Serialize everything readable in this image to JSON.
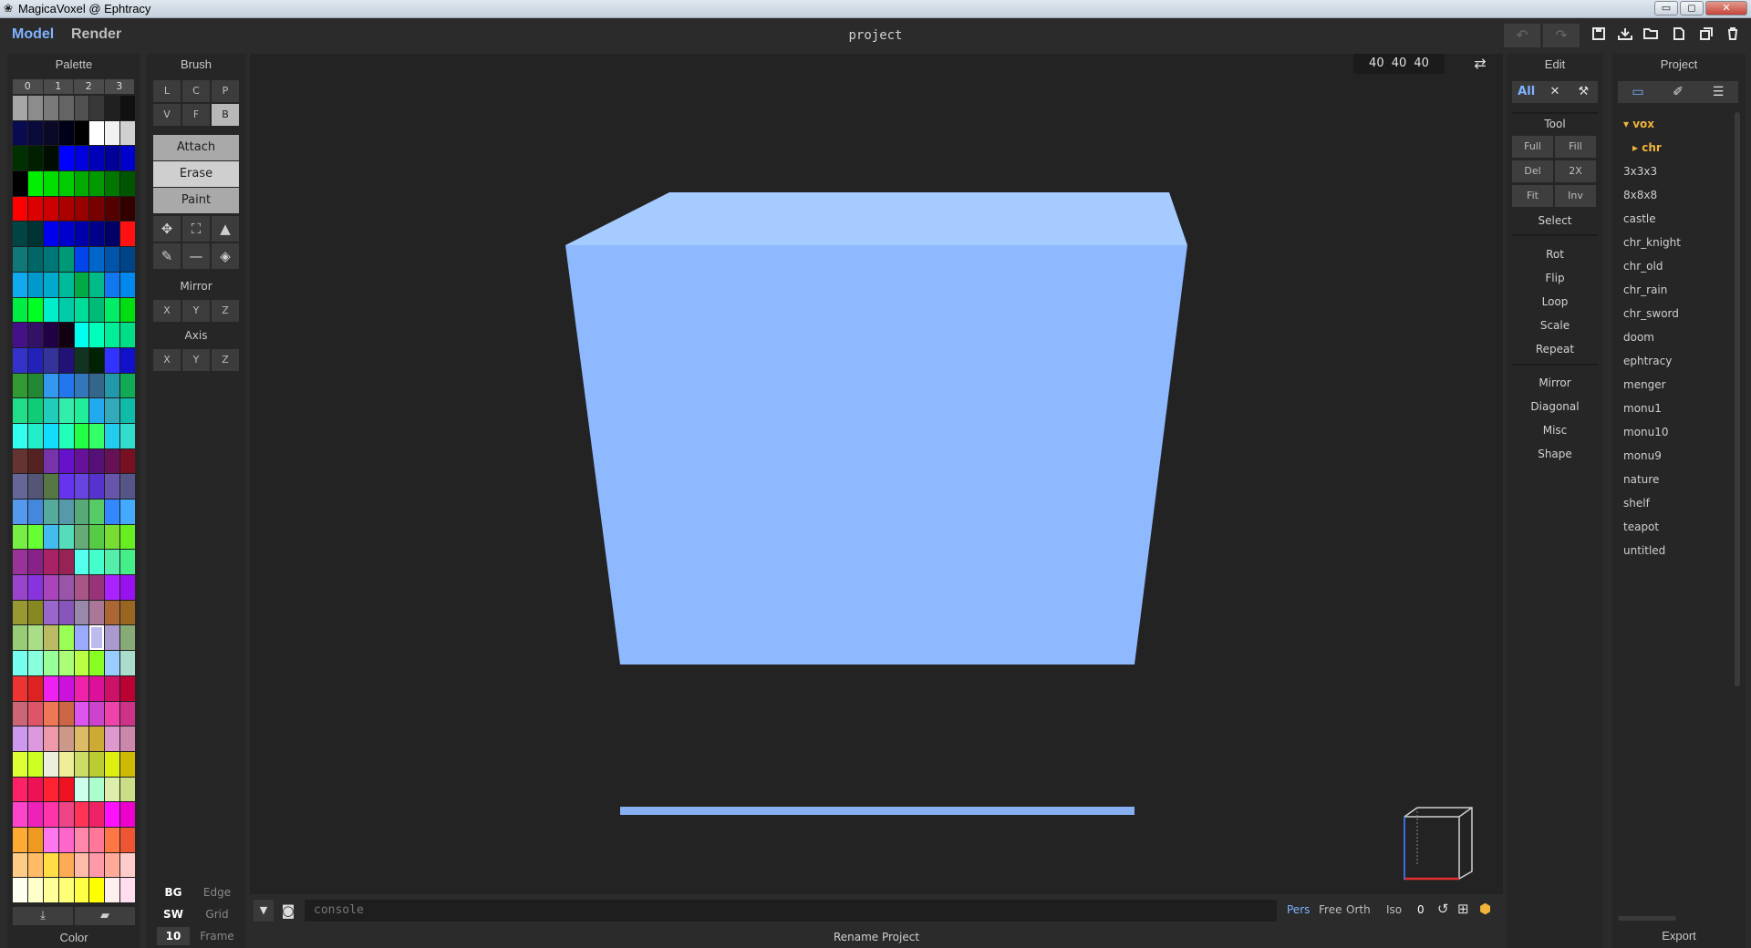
{
  "window": {
    "title": "MagicaVoxel @ Ephtracy",
    "minimize": "▭",
    "maximize": "◻",
    "close": "✕"
  },
  "header": {
    "modes": [
      "Model",
      "Render"
    ],
    "active_mode": "Model",
    "project_title": "project",
    "icons": [
      "undo-icon",
      "redo-icon",
      "save-icon",
      "save-as-icon",
      "open-icon",
      "new-icon",
      "duplicate-icon",
      "delete-icon"
    ]
  },
  "palette": {
    "title": "Palette",
    "tabs": [
      "0",
      "1",
      "2",
      "3"
    ],
    "footer_label": "Color",
    "selected_index": 173,
    "colors": [
      "#a6a6a6",
      "#8c8c8c",
      "#7a7a7a",
      "#646464",
      "#505050",
      "#383838",
      "#202020",
      "#101010",
      "#0a0a50",
      "#0a0a3a",
      "#0a0a28",
      "#000018",
      "#000000",
      "#ffffff",
      "#f2f2f2",
      "#d0d0d0",
      "#003000",
      "#002000",
      "#000e00",
      "#0000ff",
      "#0000dd",
      "#0000bb",
      "#000099",
      "#0000cc",
      "#000000",
      "#00ee00",
      "#00dd00",
      "#00cc00",
      "#00aa00",
      "#009900",
      "#007700",
      "#005500",
      "#ff0000",
      "#dd0000",
      "#cc0000",
      "#aa0000",
      "#990000",
      "#770000",
      "#550000",
      "#330000",
      "#004444",
      "#003333",
      "#0000ee",
      "#0000cc",
      "#0000aa",
      "#000088",
      "#000066",
      "#ff1111",
      "#117777",
      "#006666",
      "#007777",
      "#009977",
      "#0044ee",
      "#0066cc",
      "#0055aa",
      "#004488",
      "#11aaee",
      "#0099cc",
      "#00aacc",
      "#00bb99",
      "#00aa44",
      "#00bb88",
      "#1177ee",
      "#0088ee",
      "#00ee44",
      "#00ff22",
      "#00eecc",
      "#00ccaa",
      "#00dd99",
      "#00bb77",
      "#00ee66",
      "#00dd11",
      "#441188",
      "#331166",
      "#220044",
      "#110011",
      "#00ffee",
      "#00ffbb",
      "#00ee99",
      "#00dd88",
      "#3333cc",
      "#2222bb",
      "#333399",
      "#221177",
      "#113322",
      "#002200",
      "#3333ff",
      "#1111cc",
      "#339933",
      "#228833",
      "#3399ee",
      "#2277ee",
      "#3377bb",
      "#336688",
      "#2299aa",
      "#11aa55",
      "#22dd88",
      "#11cc77",
      "#22ccbb",
      "#33eeaa",
      "#22ee99",
      "#22aaee",
      "#33aabb",
      "#11bbaa",
      "#33ffee",
      "#22eecc",
      "#11ddff",
      "#22ffbb",
      "#22ff44",
      "#33ff66",
      "#22ccee",
      "#33ddcc",
      "#663333",
      "#552222",
      "#7733aa",
      "#6611cc",
      "#661199",
      "#551177",
      "#661155",
      "#771122",
      "#666699",
      "#555577",
      "#557744",
      "#6633ee",
      "#6644dd",
      "#5533cc",
      "#6655aa",
      "#555588",
      "#5599ee",
      "#4488dd",
      "#55aa99",
      "#5599aa",
      "#55aa77",
      "#55cc66",
      "#3388ff",
      "#44aaff",
      "#77ee44",
      "#66ff33",
      "#44bbee",
      "#55ddbb",
      "#66aa77",
      "#55cc44",
      "#77dd33",
      "#66ee22",
      "#993399",
      "#882288",
      "#aa2266",
      "#992255",
      "#55ffee",
      "#44ffcc",
      "#55eeaa",
      "#44ee88",
      "#9944cc",
      "#8833dd",
      "#aa44bb",
      "#9955aa",
      "#aa5588",
      "#993377",
      "#aa22ff",
      "#9911ee",
      "#999933",
      "#888822",
      "#9966cc",
      "#8855bb",
      "#9988aa",
      "#aa7799",
      "#aa6633",
      "#996622",
      "#99cc77",
      "#aadd88",
      "#bbbb66",
      "#99ff55",
      "#99aaff",
      "#bbbbee",
      "#aa99cc",
      "#88aa77",
      "#77ffee",
      "#88ffdd",
      "#99ff99",
      "#aaff77",
      "#bbff44",
      "#88ff22",
      "#99ccff",
      "#aaddcc",
      "#ee3333",
      "#dd2222",
      "#ee22ee",
      "#cc11dd",
      "#ee22aa",
      "#dd1199",
      "#cc1166",
      "#bb0033",
      "#cc6677",
      "#dd5566",
      "#ee7755",
      "#cc6644",
      "#dd55ee",
      "#cc44cc",
      "#ee44aa",
      "#cc3388",
      "#cc99ee",
      "#dd99dd",
      "#ee99aa",
      "#cc9988",
      "#ddbb66",
      "#ccaa33",
      "#dd99cc",
      "#cc88aa",
      "#ddff33",
      "#ccff22",
      "#eeeedd",
      "#eeee99",
      "#ccdd66",
      "#bbcc33",
      "#ddee11",
      "#ccbb00",
      "#ff2266",
      "#ee1155",
      "#ff2233",
      "#ee1122",
      "#ccffee",
      "#aaffcc",
      "#ddeeaa",
      "#ccdd88",
      "#ff44cc",
      "#ee22bb",
      "#ff33aa",
      "#ee4488",
      "#ff3355",
      "#ee2266",
      "#ff11ff",
      "#ee00cc",
      "#ffaa33",
      "#ee9922",
      "#ff77ee",
      "#ff66cc",
      "#ff88aa",
      "#ff7799",
      "#ff7744",
      "#ee5533",
      "#ffcc88",
      "#ffbb66",
      "#ffdd44",
      "#ffaa55",
      "#ffbbaa",
      "#ff99aa",
      "#ffaa99",
      "#ffcccc",
      "#fffff0",
      "#ffffcc",
      "#ffff99",
      "#ffff77",
      "#ffff44",
      "#ffff00",
      "#ffeeee",
      "#ffddee"
    ]
  },
  "brush": {
    "title": "Brush",
    "types": [
      "L",
      "C",
      "P",
      "V",
      "F",
      "B"
    ],
    "active_type": "B",
    "modes": [
      "Attach",
      "Erase",
      "Paint"
    ],
    "active_mode": "Erase",
    "tools": [
      "move-icon",
      "select-box-icon",
      "text-icon",
      "eyedropper-icon",
      "line-icon",
      "bucket-icon"
    ],
    "mirror_label": "Mirror",
    "axis_label": "Axis",
    "xyz": [
      "X",
      "Y",
      "Z"
    ],
    "bottom": {
      "bg": "BG",
      "edge": "Edge",
      "sw": "SW",
      "grid": "Grid",
      "frame_value": "10",
      "frame": "Frame"
    }
  },
  "viewport": {
    "dims": "40 40 40",
    "cube_color": "#8fb9ff",
    "cube_top_color": "#a6ccff",
    "gizmo_icon": "view-cube-icon"
  },
  "console": {
    "placeholder": "console",
    "view_modes": [
      "Pers",
      "Free",
      "Orth",
      "Iso"
    ],
    "active_view": "Pers",
    "zoom_value": "0",
    "status": "Rename Project"
  },
  "edit": {
    "title": "Edit",
    "tabs": [
      "All",
      "expand-icon",
      "wrench-icon"
    ],
    "tool_label": "Tool",
    "buttons": [
      "Full",
      "Fill",
      "Del",
      "2X",
      "Fit",
      "Inv"
    ],
    "select_label": "Select",
    "transforms": [
      "Rot",
      "Flip",
      "Loop",
      "Scale",
      "Repeat"
    ],
    "shapes": [
      "Mirror",
      "Diagonal",
      "Misc",
      "Shape"
    ]
  },
  "project": {
    "title": "Project",
    "tabs": [
      "folder-icon",
      "brush-icon",
      "list-icon"
    ],
    "root_folder": "vox",
    "sub_folder": "chr",
    "files": [
      "3x3x3",
      "8x8x8",
      "castle",
      "chr_knight",
      "chr_old",
      "chr_rain",
      "chr_sword",
      "doom",
      "ephtracy",
      "menger",
      "monu1",
      "monu10",
      "monu9",
      "nature",
      "shelf",
      "teapot",
      "untitled"
    ],
    "export_label": "Export"
  }
}
